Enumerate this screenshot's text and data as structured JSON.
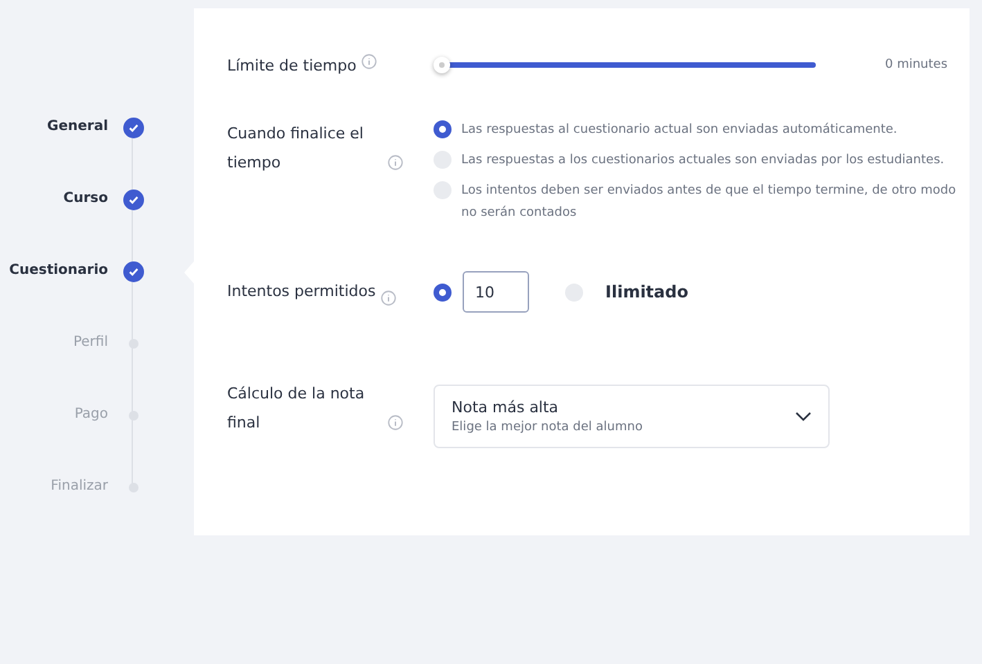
{
  "steps": [
    {
      "label": "General",
      "done": true,
      "selected": false
    },
    {
      "label": "Curso",
      "done": true,
      "selected": false
    },
    {
      "label": "Cuestionario",
      "done": true,
      "selected": true
    },
    {
      "label": "Perfil",
      "done": false,
      "selected": false
    },
    {
      "label": "Pago",
      "done": false,
      "selected": false
    },
    {
      "label": "Finalizar",
      "done": false,
      "selected": false
    }
  ],
  "time_limit": {
    "label": "Límite de tiempo",
    "level": 0,
    "reading": "0 minutes"
  },
  "on_finish": {
    "label": "Cuando finalice el tiempo",
    "options": [
      {
        "text": "Las respuestas al cuestionario actual son enviadas automáticamente.",
        "selected": true
      },
      {
        "text": "Las respuestas a los cuestionarios actuales son enviadas por los estudiantes.",
        "selected": false
      },
      {
        "text": "Los intentos deben ser enviados antes de que el tiempo termine, de otro modo no serán contados",
        "selected": false
      }
    ]
  },
  "attempts": {
    "label": "Intentos permitidos",
    "count_selected": true,
    "value": "10",
    "unlimited_label": "Ilimitado",
    "unlimited_selected": false
  },
  "grading": {
    "label": "Cálculo de la nota final",
    "value": "Nota más alta",
    "description": "Elige la mejor nota del alumno"
  }
}
